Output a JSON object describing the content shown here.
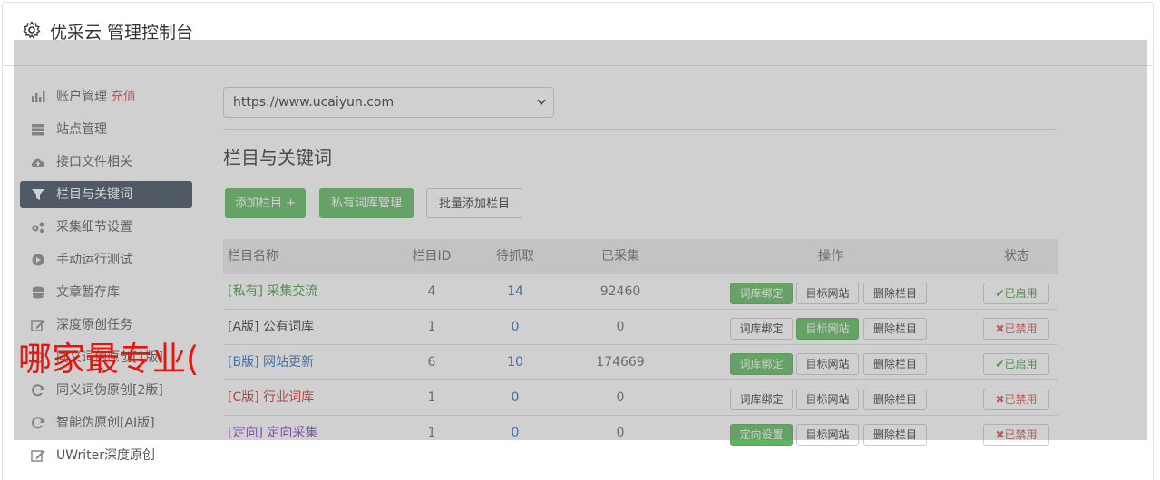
{
  "header": {
    "title": "优采云 管理控制台",
    "icon": "gear-icon"
  },
  "sidebar": {
    "items": [
      {
        "label": "账户管理",
        "extra": "充值",
        "icon": "bar-chart-icon"
      },
      {
        "label": "站点管理",
        "icon": "server-icon"
      },
      {
        "label": "接口文件相关",
        "icon": "cloud-upload-icon"
      },
      {
        "label": "栏目与关键词",
        "icon": "filter-icon",
        "active": true
      },
      {
        "label": "采集细节设置",
        "icon": "gears-icon"
      },
      {
        "label": "手动运行测试",
        "icon": "play-circle-icon"
      },
      {
        "label": "文章暂存库",
        "icon": "database-icon"
      },
      {
        "label": "深度原创任务",
        "icon": "edit-icon"
      },
      {
        "label": "同义词伪原创[1版]",
        "icon": "refresh-icon"
      },
      {
        "label": "同义词伪原创[2版]",
        "icon": "refresh-icon"
      },
      {
        "label": "智能伪原创[AI版]",
        "icon": "refresh-icon"
      },
      {
        "label": "UWriter深度原创",
        "icon": "edit-icon"
      }
    ]
  },
  "site_select": {
    "value": "https://www.ucaiyun.com"
  },
  "section_title": "栏目与关键词",
  "buttons": {
    "add_column": "添加栏目 +",
    "private_lexicon": "私有词库管理",
    "batch_add": "批量添加栏目"
  },
  "table": {
    "headers": {
      "name": "栏目名称",
      "id": "栏目ID",
      "wait": "待抓取",
      "done": "已采集",
      "op": "操作",
      "status": "状态"
    },
    "rows": [
      {
        "tag": "[私有]",
        "name": "采集交流",
        "id": "4",
        "wait": "14",
        "done": "92460",
        "op1": "词库绑定",
        "op2": "目标网站",
        "op3": "删除栏目",
        "op1_active": true,
        "op2_active": false,
        "status": "已启用",
        "enabled": true,
        "color": "#3c9a3c"
      },
      {
        "tag": "[A版]",
        "name": "公有词库",
        "id": "1",
        "wait": "0",
        "done": "0",
        "op1": "词库绑定",
        "op2": "目标网站",
        "op3": "删除栏目",
        "op1_active": false,
        "op2_active": true,
        "status": "已禁用",
        "enabled": false,
        "color": "#333333"
      },
      {
        "tag": "[B版]",
        "name": "网站更新",
        "id": "6",
        "wait": "10",
        "done": "174669",
        "op1": "词库绑定",
        "op2": "目标网站",
        "op3": "删除栏目",
        "op1_active": true,
        "op2_active": false,
        "status": "已启用",
        "enabled": true,
        "color": "#2a6dbf"
      },
      {
        "tag": "[C版]",
        "name": "行业词库",
        "id": "1",
        "wait": "0",
        "done": "0",
        "op1": "词库绑定",
        "op2": "目标网站",
        "op3": "删除栏目",
        "op1_active": false,
        "op2_active": false,
        "status": "已禁用",
        "enabled": false,
        "color": "#c9302c"
      },
      {
        "tag": "[定向]",
        "name": "定向采集",
        "id": "1",
        "wait": "0",
        "done": "0",
        "op1": "定向设置",
        "op2": "目标网站",
        "op3": "删除栏目",
        "op1_active": true,
        "op2_active": false,
        "status": "已禁用",
        "enabled": false,
        "color": "#7b3fd1"
      }
    ]
  },
  "watermark": "哪家最专业("
}
